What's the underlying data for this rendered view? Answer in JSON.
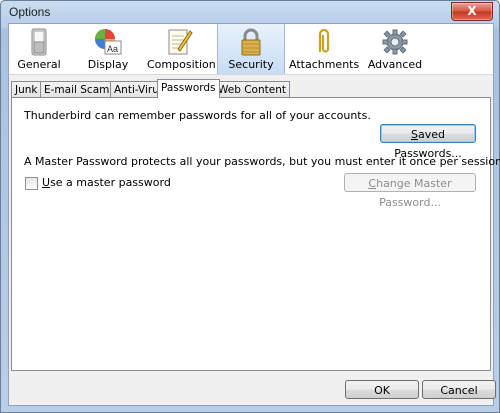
{
  "window": {
    "title": "Options",
    "close_label": "X"
  },
  "toolbar": {
    "items": [
      {
        "label": "General",
        "icon": "switch-icon"
      },
      {
        "label": "Display",
        "icon": "palette-icon"
      },
      {
        "label": "Composition",
        "icon": "notepad-pencil-icon"
      },
      {
        "label": "Security",
        "icon": "padlock-icon",
        "selected": true
      },
      {
        "label": "Attachments",
        "icon": "paperclip-icon"
      },
      {
        "label": "Advanced",
        "icon": "gear-icon"
      }
    ]
  },
  "tabs": [
    "Junk",
    "E-mail Scams",
    "Anti-Virus",
    "Passwords",
    "Web Content"
  ],
  "active_tab": "Passwords",
  "passwords": {
    "remember_text": "Thunderbird can remember passwords for all of your accounts.",
    "saved_button_pre": "",
    "saved_button_u": "S",
    "saved_button_post": "aved Passwords...",
    "master_text": "A Master Password protects all your passwords, but you must enter it once per session.",
    "use_master_u": "U",
    "use_master_post": "se a master password",
    "use_master_checked": false,
    "change_master_pre": "",
    "change_master_u": "C",
    "change_master_post": "hange Master Password..."
  },
  "footer": {
    "ok_label": "OK",
    "cancel_label": "Cancel"
  }
}
